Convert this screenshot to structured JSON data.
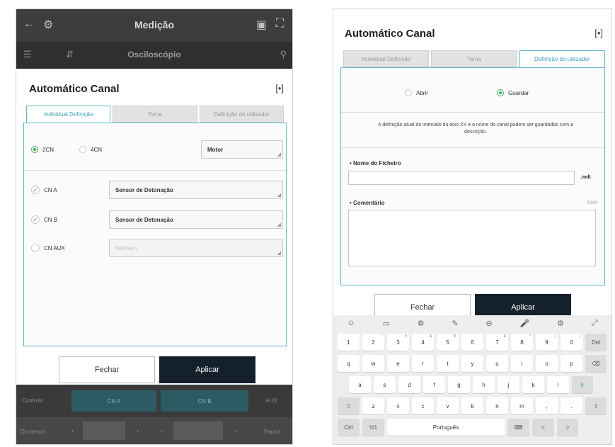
{
  "left": {
    "app": {
      "title": "Medição",
      "subtitle": "Osciloscópio",
      "back_icon": "back-arrow-icon",
      "settings_icon": "gear-icon"
    },
    "dialog": {
      "title": "Automático Canal",
      "expand_glyph": "[•]",
      "tabs": [
        "Individual Definição",
        "Tema",
        "Definição do utilizador"
      ],
      "channel_modes": [
        "2CN",
        "4CN"
      ],
      "channel_mode_selected": "2CN",
      "mode_select_value": "Motor",
      "channels": [
        {
          "label": "CN A",
          "checked": true,
          "sensor": "Sensor de Detonação"
        },
        {
          "label": "CN B",
          "checked": true,
          "sensor": "Sensor de Detonação"
        },
        {
          "label": "CN AUX",
          "checked": false,
          "sensor": "Nenhum"
        }
      ],
      "close_label": "Fechar",
      "apply_label": "Aplicar"
    },
    "bottom": {
      "ch_labels": [
        "CN A",
        "CN B"
      ],
      "left_label": "Controlo",
      "right_label": "AUX",
      "nav_left": "Div.tempo",
      "nav_right": "Pausa"
    }
  },
  "right": {
    "dialog": {
      "title": "Automático Canal",
      "expand_glyph": "[•]",
      "tabs": [
        "Individual Definição",
        "Tema",
        "Definição do utilizador"
      ],
      "options": [
        "Abrir",
        "Guardar"
      ],
      "option_selected": "Guardar",
      "description": "A definição atual do intervalo do eixo XY e o nome do canal podem ser guardados com a descrição.",
      "filename_label": "Nome do Ficheiro",
      "filename_value": "",
      "filename_ext": ".mdt",
      "comment_label": "Comentário",
      "comment_counter": "0/300",
      "close_label": "Fechar",
      "apply_label": "Aplicar"
    },
    "keyboard": {
      "tools": [
        "☺",
        "▭",
        "⚙",
        "✎",
        "⊖",
        "🎤",
        "⚙",
        "⤢"
      ],
      "row1": [
        {
          "k": "1",
          "s": ""
        },
        {
          "k": "2",
          "s": "\""
        },
        {
          "k": "3",
          "s": "#"
        },
        {
          "k": "4",
          "s": "$"
        },
        {
          "k": "5",
          "s": "%"
        },
        {
          "k": "6",
          "s": ""
        },
        {
          "k": "7",
          "s": "&"
        },
        {
          "k": "8",
          "s": "*"
        },
        {
          "k": "9",
          "s": "("
        },
        {
          "k": "0",
          "s": ")"
        }
      ],
      "row1_extra": "Del",
      "row2": [
        "q",
        "w",
        "e",
        "r",
        "t",
        "y",
        "u",
        "i",
        "o",
        "p"
      ],
      "row2_extra": "⌫",
      "row3": [
        "a",
        "s",
        "d",
        "f",
        "g",
        "h",
        "j",
        "k",
        "l"
      ],
      "row3_extra": "Ir",
      "row4": [
        "z",
        "x",
        "c",
        "v",
        "b",
        "n",
        "m",
        ",",
        "."
      ],
      "shift": "⇧",
      "row5": [
        "Ctrl",
        "!#1",
        "Português",
        "⌨",
        "<",
        ">"
      ]
    }
  }
}
